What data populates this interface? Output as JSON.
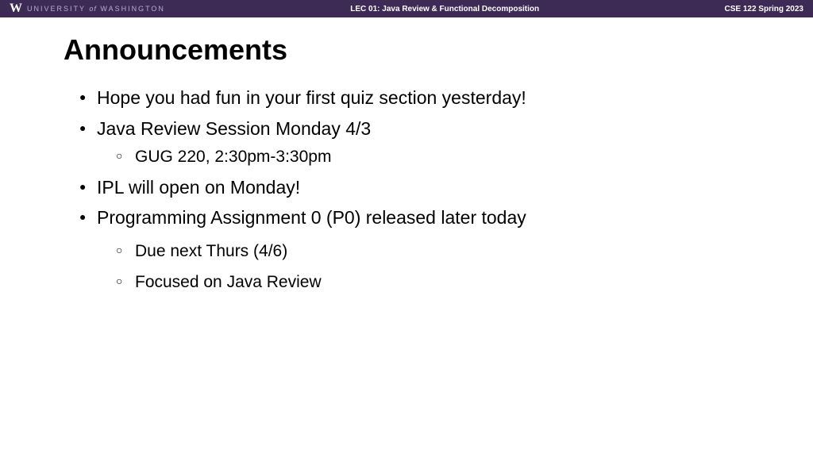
{
  "header": {
    "uw_logo": "W",
    "uw_text_1": "UNIVERSITY",
    "uw_of": "of",
    "uw_text_2": "WASHINGTON",
    "lecture_title": "LEC 01: Java Review & Functional Decomposition",
    "course_info": "CSE 122 Spring 2023"
  },
  "content": {
    "title": "Announcements",
    "items": [
      {
        "text": "Hope you had fun in your first quiz section yesterday!"
      },
      {
        "text": "Java Review Session Monday 4/3",
        "sub": [
          "GUG 220, 2:30pm-3:30pm"
        ]
      },
      {
        "text": "IPL will open on Monday!"
      },
      {
        "text": "Programming Assignment 0 (P0) released later today",
        "sub": [
          "Due next Thurs (4/6)",
          "Focused on Java Review"
        ],
        "spaced": true
      }
    ]
  }
}
